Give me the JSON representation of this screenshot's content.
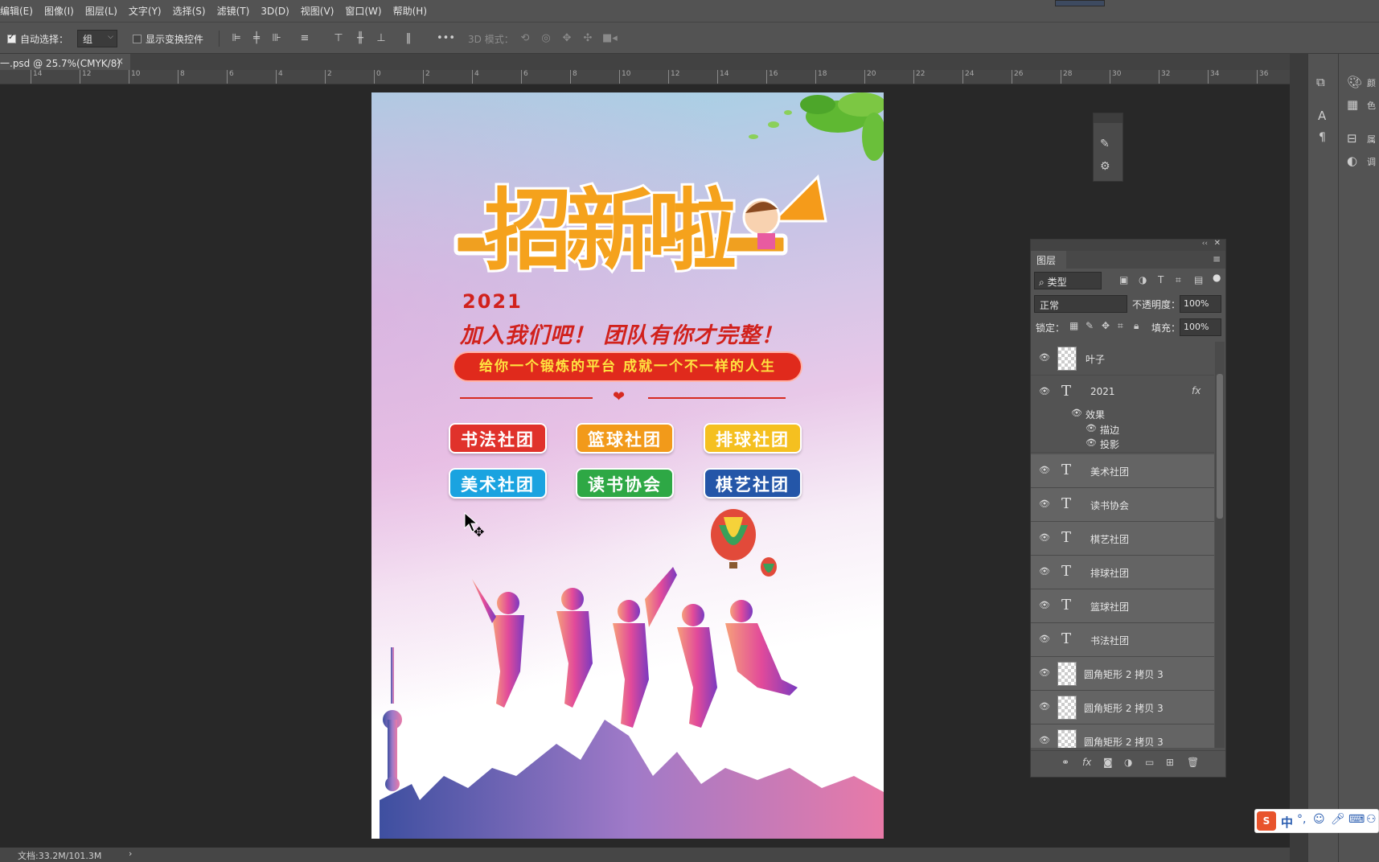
{
  "menu": [
    "编辑(E)",
    "图像(I)",
    "图层(L)",
    "文字(Y)",
    "选择(S)",
    "滤镜(T)",
    "3D(D)",
    "视图(V)",
    "窗口(W)",
    "帮助(H)"
  ],
  "options": {
    "auto_select_label": "自动选择：",
    "auto_select_value": "组",
    "show_transform_label": "显示变换控件",
    "mode_3d_label": "3D 模式："
  },
  "doc_tab": {
    "title": "一.psd @ 25.7%(CMYK/8)",
    "close": "×"
  },
  "ruler_ticks": [
    "14",
    "12",
    "10",
    "8",
    "6",
    "4",
    "2",
    "0",
    "2",
    "4",
    "6",
    "8",
    "10",
    "12",
    "14",
    "16",
    "18",
    "20",
    "22",
    "24",
    "26",
    "28",
    "30",
    "32",
    "34",
    "36"
  ],
  "poster": {
    "year": "2021",
    "slogan": "加入我们吧！ 团队有你才完整！",
    "banner": "给你一个锻炼的平台  成就一个不一样的人生",
    "headline": "招新啦",
    "heart": "❤",
    "clubs": [
      {
        "label": "书法社团",
        "color": "#e0322b"
      },
      {
        "label": "篮球社团",
        "color": "#f29a1a"
      },
      {
        "label": "排球社团",
        "color": "#f5c020"
      },
      {
        "label": "美术社团",
        "color": "#1aa3e0"
      },
      {
        "label": "读书协会",
        "color": "#2ea845"
      },
      {
        "label": "棋艺社团",
        "color": "#2456a8"
      }
    ]
  },
  "layers_panel": {
    "tab": "图层",
    "filter_kind": "类型",
    "blend_mode": "正常",
    "opacity_label": "不透明度：",
    "opacity_value": "100%",
    "lock_label": "锁定：",
    "fill_label": "填充：",
    "fill_value": "100%",
    "fx_label": "fx",
    "effects_label": "效果",
    "effect_items": [
      "描边",
      "投影"
    ],
    "layers": [
      {
        "name": "叶子",
        "kind": "image"
      },
      {
        "name": "2021",
        "kind": "text"
      },
      {
        "name": "美术社团",
        "kind": "text"
      },
      {
        "name": "读书协会",
        "kind": "text"
      },
      {
        "name": "棋艺社团",
        "kind": "text"
      },
      {
        "name": "排球社团",
        "kind": "text"
      },
      {
        "name": "篮球社团",
        "kind": "text"
      },
      {
        "name": "书法社团",
        "kind": "text"
      },
      {
        "name": "圆角矩形 2 拷贝 3",
        "kind": "shape"
      },
      {
        "name": "圆角矩形 2 拷贝 3",
        "kind": "shape"
      },
      {
        "name": "圆角矩形 2 拷贝 3",
        "kind": "shape"
      }
    ]
  },
  "right_dock": {
    "labels": [
      "颜",
      "色",
      "属",
      "调"
    ]
  },
  "status": {
    "doc_size": "文档:33.2M/101.3M"
  },
  "ime": {
    "text": "中"
  }
}
